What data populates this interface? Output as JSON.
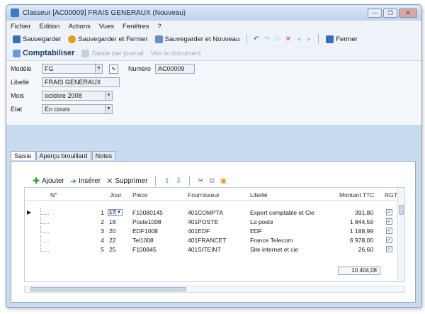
{
  "window": {
    "title": "Classeur [AC00009] FRAIS GENERAUX (Nouveau)",
    "controls": [
      "—",
      "❐",
      "✕"
    ]
  },
  "menu": [
    "Fichier",
    "Edition",
    "Actions",
    "Vues",
    "Fenêtres",
    "?"
  ],
  "toolbar": {
    "save": "Sauvegarder",
    "save_close": "Sauvegarder et Fermer",
    "save_new": "Sauvegarder et Nouveau",
    "close": "Fermer",
    "comptabiliser": "Comptabiliser",
    "saisie_journal": "Saisie par journal",
    "voir_document": "Voir le document"
  },
  "form": {
    "modele_label": "Modèle",
    "modele_value": "FG",
    "numero_label": "Numéro",
    "numero_value": "AC00009",
    "libelle_label": "Libellé",
    "libelle_value": "FRAIS GENERAUX",
    "mois_label": "Mois",
    "mois_value": "octobre 2008",
    "etat_label": "Etat",
    "etat_value": "En cours"
  },
  "tabs": [
    "Saisie",
    "Aperçu brouillard",
    "Notes"
  ],
  "grid_tools": {
    "add": "Ajouter",
    "insert": "Insérer",
    "delete": "Supprimer"
  },
  "grid": {
    "headers": {
      "n": "N°",
      "jour": "Jour",
      "piece": "Pièce",
      "fournisseur": "Fournisseur",
      "libelle": "Libellé",
      "montant": "Montant TTC",
      "rgt": "RGT"
    },
    "rows": [
      {
        "num": "1",
        "jour": "17",
        "piece": "F10080145",
        "fournisseur": "401COMPTA",
        "libelle": "Expert comptable et Cie",
        "montant": "391,80"
      },
      {
        "num": "2",
        "jour": "18",
        "piece": "Poste1008",
        "fournisseur": "401POSTE",
        "libelle": "La poste",
        "montant": "1 844,59"
      },
      {
        "num": "3",
        "jour": "20",
        "piece": "EDF1008",
        "fournisseur": "401EDF",
        "libelle": "EDF",
        "montant": "1 188,99"
      },
      {
        "num": "4",
        "jour": "22",
        "piece": "Tel1008",
        "fournisseur": "401FRANCET",
        "libelle": "France Telecom",
        "montant": "6 978,00"
      },
      {
        "num": "5",
        "jour": "25",
        "piece": "F100845",
        "fournisseur": "401SITEINT",
        "libelle": "Site internet et cie",
        "montant": "26,60"
      }
    ],
    "total": "10 404,08"
  }
}
